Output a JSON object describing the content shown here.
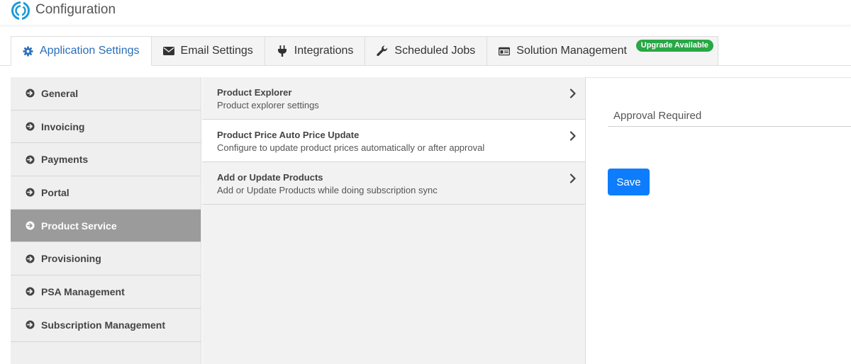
{
  "app": {
    "title": "Configuration",
    "logo_icon": "circular-logo-icon",
    "accent": "#2a6ebb"
  },
  "tabs": [
    {
      "label": "Application Settings",
      "icon": "gear-icon",
      "active": true
    },
    {
      "label": "Email Settings",
      "icon": "envelope-icon"
    },
    {
      "label": "Integrations",
      "icon": "plug-icon"
    },
    {
      "label": "Scheduled Jobs",
      "icon": "wrench-icon"
    },
    {
      "label": "Solution Management",
      "icon": "id-card-icon",
      "badge": "Upgrade Available",
      "badge_color": "#28a745"
    }
  ],
  "sidebar": {
    "items": [
      {
        "label": "General"
      },
      {
        "label": "Invoicing"
      },
      {
        "label": "Payments"
      },
      {
        "label": "Portal"
      },
      {
        "label": "Product Service",
        "active": true
      },
      {
        "label": "Provisioning"
      },
      {
        "label": "PSA Management"
      },
      {
        "label": "Subscription Management"
      }
    ]
  },
  "settings_list": [
    {
      "title": "Product Explorer",
      "description": "Product explorer settings"
    },
    {
      "title": "Product Price Auto Price Update",
      "description": "Configure to update product prices automatically or after approval",
      "selected": true
    },
    {
      "title": "Add or Update Products",
      "description": "Add or Update Products while doing subscription sync"
    }
  ],
  "detail": {
    "field_value": "Approval Required",
    "save_label": "Save",
    "save_color": "#0d7dfd"
  }
}
